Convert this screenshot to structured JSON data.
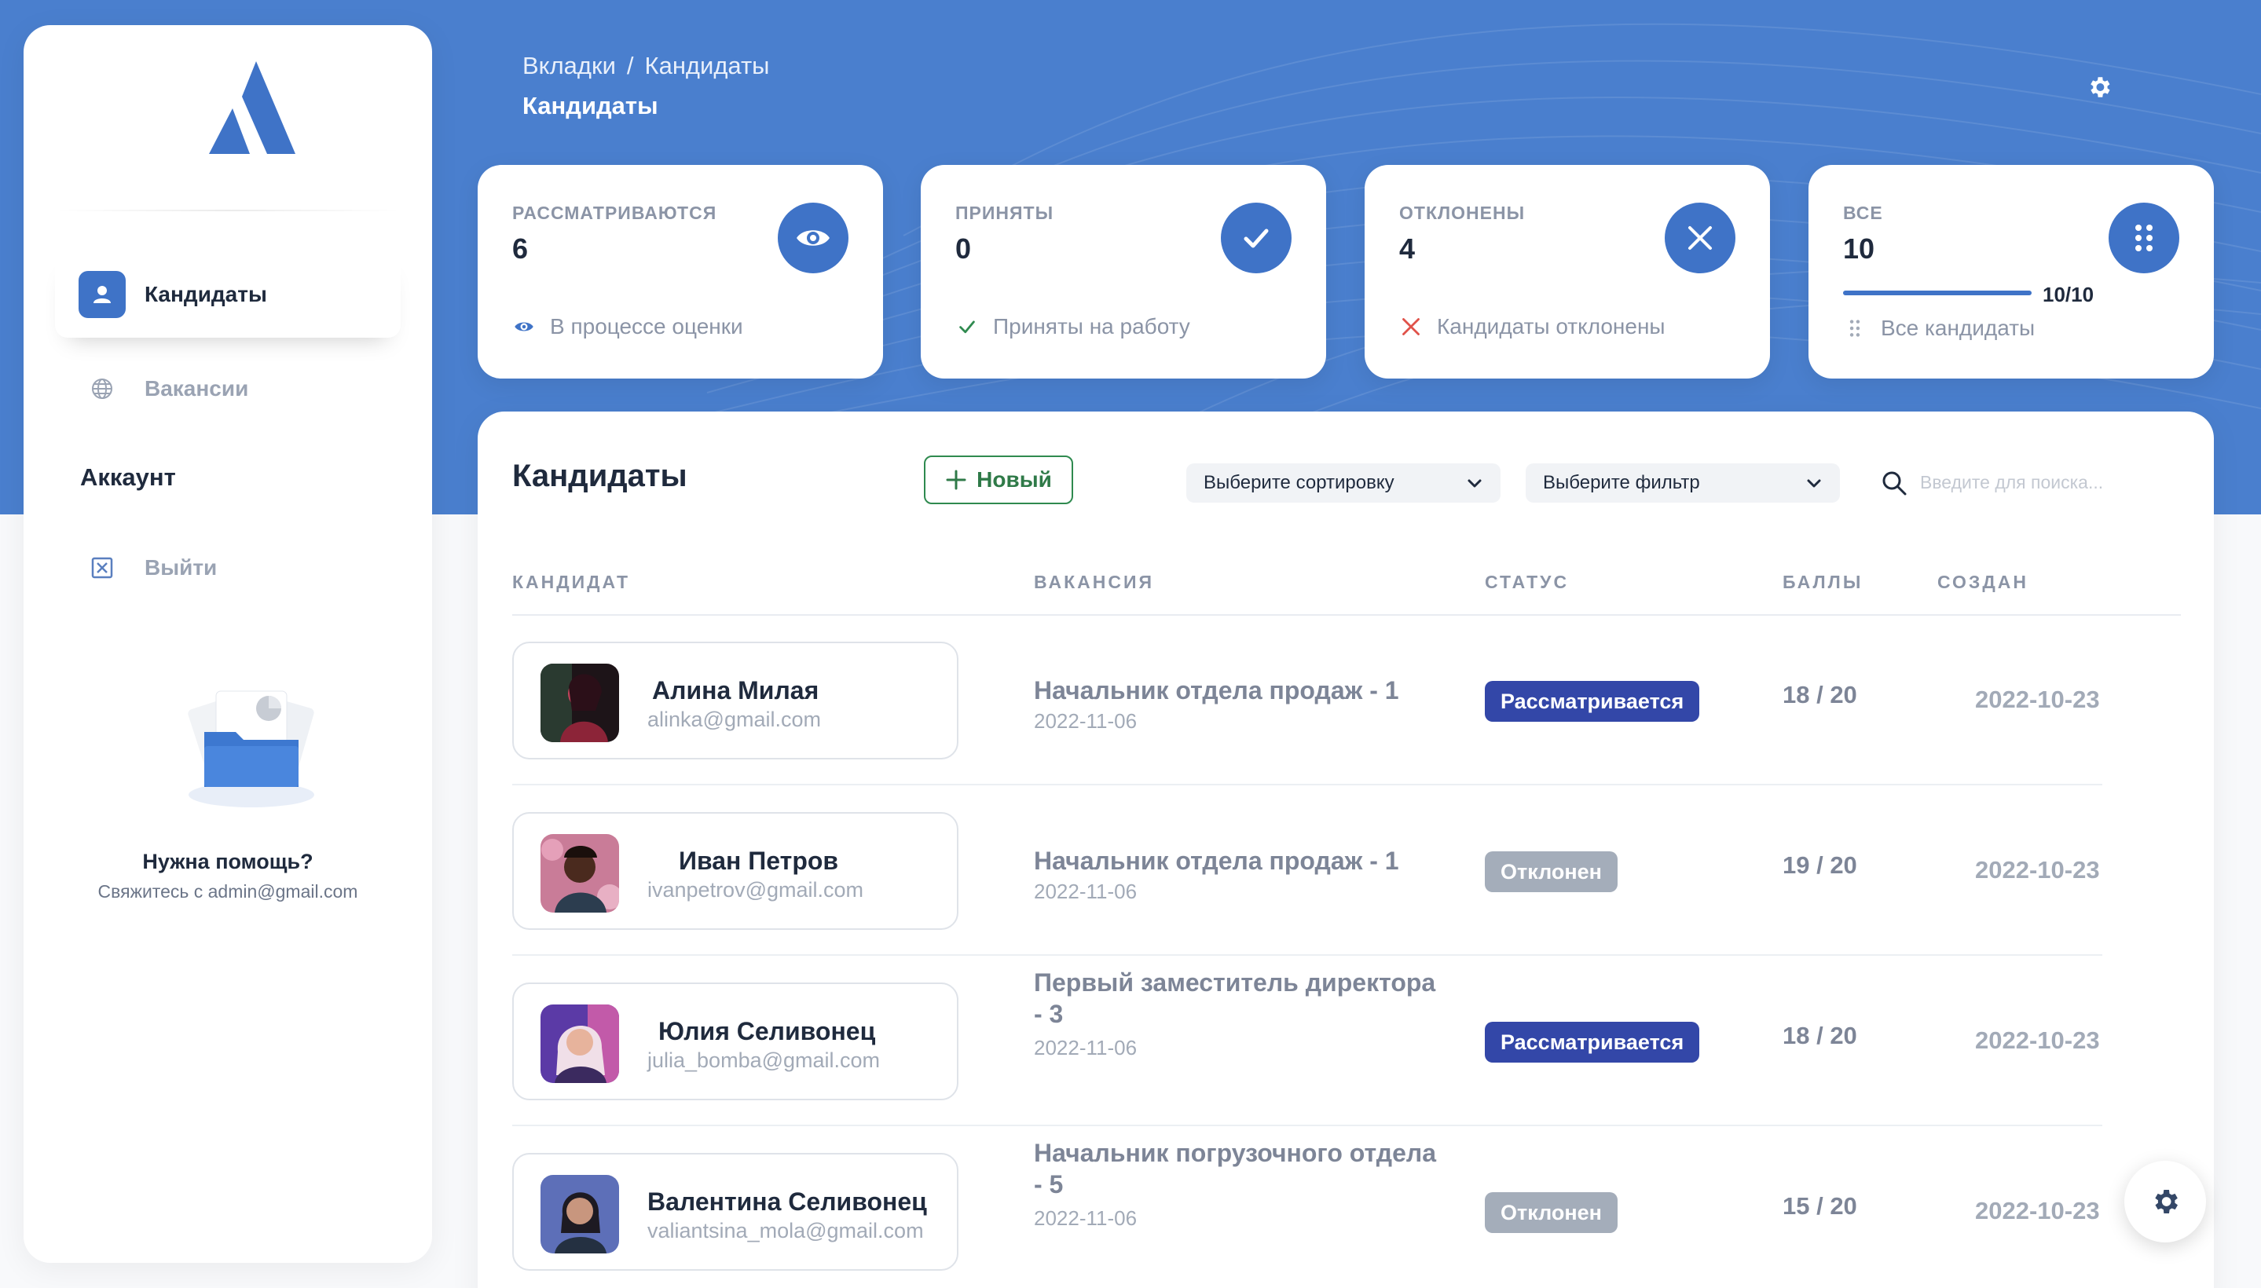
{
  "brand": {
    "accent": "#3f73c7",
    "hero_bg": "#4a7fce",
    "success": "#2f8a4f",
    "danger": "#e0524a"
  },
  "sidebar": {
    "logo_icon": "triangle-logo-icon",
    "items": [
      {
        "label": "Кандидаты",
        "icon": "user-icon",
        "active": true
      },
      {
        "label": "Вакансии",
        "icon": "globe-icon",
        "active": false
      }
    ],
    "account_title": "Аккаунт",
    "logout": {
      "label": "Выйти",
      "icon": "close-square-icon"
    },
    "help": {
      "title": "Нужна помощь?",
      "subtitle": "Свяжитесь с admin@gmail.com"
    }
  },
  "header": {
    "breadcrumb": [
      "Вкладки",
      "/",
      "Кандидаты"
    ],
    "title": "Кандидаты",
    "settings_icon": "gear-icon"
  },
  "stats": [
    {
      "label": "РАССМАТРИВАЮТСЯ",
      "value": "6",
      "icon": "eye-icon",
      "footer": "В процессе оценки",
      "footer_icon": "eye-icon"
    },
    {
      "label": "ПРИНЯТЫ",
      "value": "0",
      "icon": "check-icon",
      "footer": "Приняты на работу",
      "footer_icon": "check-icon"
    },
    {
      "label": "ОТКЛОНЕНЫ",
      "value": "4",
      "icon": "close-icon",
      "footer": "Кандидаты отклонены",
      "footer_icon": "close-icon"
    },
    {
      "label": "ВСЕ",
      "value": "10",
      "icon": "grid-dots-icon",
      "footer": "Все кандидаты",
      "footer_icon": "grid-dots-icon",
      "progress_text": "10/10",
      "progress": 1.0
    }
  ],
  "main": {
    "title": "Кандидаты",
    "new_button": "Новый",
    "sort_select": "Выберите сортировку",
    "filter_select": "Выберите фильтр",
    "search_placeholder": "Введите для поиска...",
    "columns": [
      "КАНДИДАТ",
      "ВАКАНСИЯ",
      "СТАТУС",
      "БАЛЛЫ",
      "СОЗДАН"
    ],
    "rows": [
      {
        "name": "Алина Милая",
        "email": "alinka@gmail.com",
        "vacancy": "Начальник отдела продаж - 1",
        "vacancy_date": "2022-11-06",
        "status": "Рассматривается",
        "status_color": "#3347a8",
        "score": "18 / 20",
        "created": "2022-10-23"
      },
      {
        "name": "Иван Петров",
        "email": "ivanpetrov@gmail.com",
        "vacancy": "Начальник отдела продаж - 1",
        "vacancy_date": "2022-11-06",
        "status": "Отклонен",
        "status_color": "#a4adba",
        "score": "19 / 20",
        "created": "2022-10-23"
      },
      {
        "name": "Юлия Селивонец",
        "email": "julia_bomba@gmail.com",
        "vacancy": "Первый заместитель директора - 3",
        "vacancy_date": "2022-11-06",
        "status": "Рассматривается",
        "status_color": "#3347a8",
        "score": "18 / 20",
        "created": "2022-10-23"
      },
      {
        "name": "Валентина Селивонец",
        "email": "valiantsina_mola@gmail.com",
        "vacancy": "Начальник погрузочного отдела - 5",
        "vacancy_date": "2022-11-06",
        "status": "Отклонен",
        "status_color": "#a4adba",
        "score": "15 / 20",
        "created": "2022-10-23"
      }
    ]
  },
  "fab_icon": "gear-icon"
}
